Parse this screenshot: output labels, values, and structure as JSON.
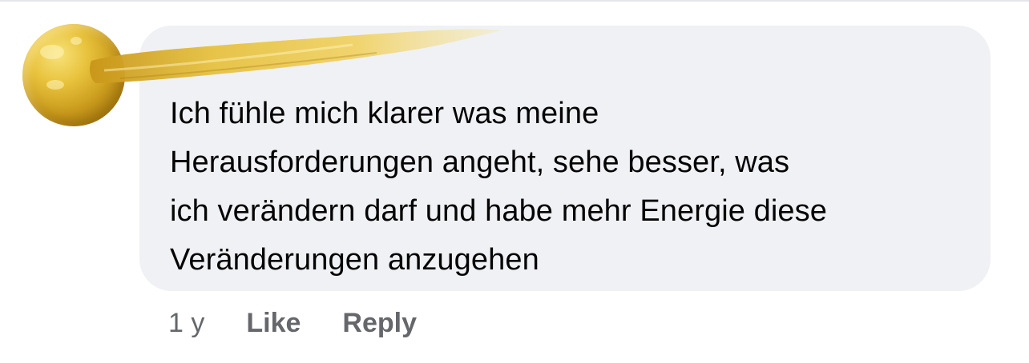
{
  "comment": {
    "text": "Ich fühle mich klarer was meine Herausforderungen angeht, sehe besser, was ich verändern darf und habe mehr Energie diese Veränderungen anzugehen",
    "lines": [
      "Ich fühle mich klarer was meine",
      "Herausforderungen angeht, sehe besser, was",
      "ich verändern darf und habe mehr Energie diese",
      "Veränderungen anzugehen"
    ],
    "timestamp": "1 y",
    "like_label": "Like",
    "reply_label": "Reply"
  },
  "colors": {
    "bubble_bg": "#f0f1f4",
    "text": "#050505",
    "meta_text": "#65676b",
    "gold": "#d9b02c"
  },
  "icons": {
    "avatar": "gold-brush-avatar-icon",
    "name_redaction": "gold-brush-stroke"
  }
}
